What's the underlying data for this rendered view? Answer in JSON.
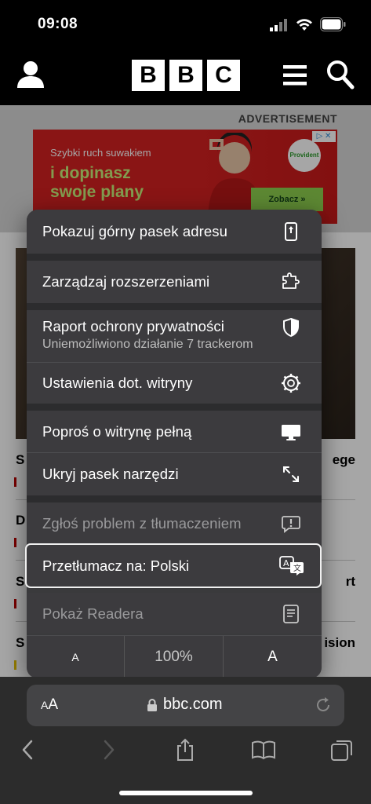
{
  "status": {
    "time": "09:08"
  },
  "header": {
    "logo_letters": [
      "B",
      "B",
      "C"
    ]
  },
  "page": {
    "ad_label": "ADVERTISEMENT",
    "ad": {
      "line1": "Szybki ruch suwakiem",
      "line2": "i dopinasz swoje plany",
      "brand": "Provident",
      "cta": "Zobacz  »",
      "choice": "▷ ✕"
    },
    "headlines": [
      {
        "left": "S",
        "right": "ege"
      },
      {
        "left": "D",
        "right": ""
      },
      {
        "left": "S",
        "right": "rt"
      },
      {
        "left": "S",
        "right": "ision"
      }
    ]
  },
  "menu": {
    "items": [
      {
        "label": "Pokazuj górny pasek adresu",
        "icon": "address-bar-icon"
      },
      {
        "label": "Zarządzaj rozszerzeniami",
        "icon": "extensions-icon"
      },
      {
        "label": "Raport ochrony prywatności",
        "sub": "Uniemożliwiono działanie 7 trackerom",
        "icon": "privacy-shield-icon"
      },
      {
        "label": "Ustawienia dot. witryny",
        "icon": "gear-icon"
      },
      {
        "label": "Poproś o witrynę pełną",
        "icon": "desktop-icon"
      },
      {
        "label": "Ukryj pasek narzędzi",
        "icon": "expand-arrows-icon"
      },
      {
        "label": "Zgłoś problem z tłumaczeniem",
        "icon": "report-bubble-icon"
      },
      {
        "label": "Przetłumacz na: Polski",
        "icon": "translate-icon"
      },
      {
        "label": "Pokaż Readera",
        "icon": "reader-icon"
      }
    ],
    "font_smaller": "A",
    "zoom": "100%",
    "font_larger": "A"
  },
  "toolbar": {
    "aa_small": "A",
    "aa_large": "A",
    "url": "bbc.com"
  }
}
